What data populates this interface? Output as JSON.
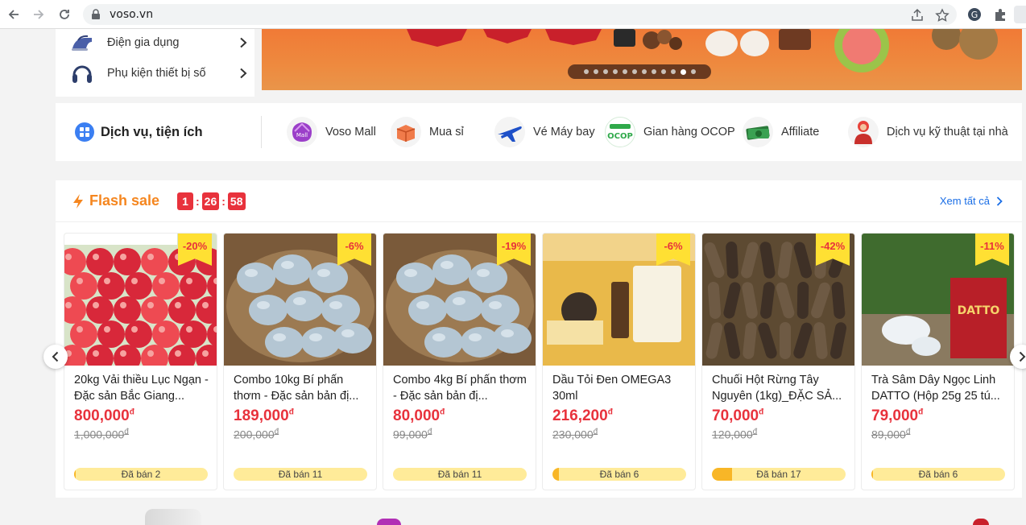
{
  "browser": {
    "url": "voso.vn"
  },
  "categories": [
    {
      "label": "Điện gia dụng",
      "icon": "iron-icon"
    },
    {
      "label": "Phụ kiện thiết bị số",
      "icon": "headphones-icon"
    }
  ],
  "banner": {
    "dot_count": 12,
    "active_dot": 10
  },
  "services": {
    "title": "Dịch vụ, tiện ích",
    "items": [
      {
        "label": "Voso Mall",
        "icon": "voso-mall-icon"
      },
      {
        "label": "Mua sỉ",
        "icon": "wholesale-box-icon"
      },
      {
        "label": "Vé Máy bay",
        "icon": "airplane-icon"
      },
      {
        "label": "Gian hàng OCOP",
        "icon": "ocop-icon"
      },
      {
        "label": "Affiliate",
        "icon": "money-icon"
      },
      {
        "label": "Dịch vụ kỹ thuật tại nhà",
        "icon": "technician-icon"
      }
    ]
  },
  "flash_sale": {
    "title": "Flash sale",
    "timer": [
      "1",
      "26",
      "58"
    ],
    "timer_sep": ":",
    "see_all": "Xem tất cả",
    "currency": "đ",
    "products": [
      {
        "name": "20kg Vải thiều Lục Ngạn - Đặc sản Bắc Giang...",
        "price": "800,000",
        "old_price": "1,000,000",
        "discount": "-20%",
        "sold": "Đã bán 2",
        "sold_ratio": 0.01
      },
      {
        "name": "Combo 10kg Bí phấn thơm - Đặc sản bản đị...",
        "price": "189,000",
        "old_price": "200,000",
        "discount": "-6%",
        "sold": "Đã bán 11",
        "sold_ratio": 0.0
      },
      {
        "name": "Combo 4kg Bí phấn thơm - Đặc sản bản đị...",
        "price": "80,000",
        "old_price": "99,000",
        "discount": "-19%",
        "sold": "Đã bán 11",
        "sold_ratio": 0.0
      },
      {
        "name": "Dầu Tỏi Đen OMEGA3 30ml",
        "price": "216,200",
        "old_price": "230,000",
        "discount": "-6%",
        "sold": "Đã bán 6",
        "sold_ratio": 0.05
      },
      {
        "name": "Chuối Hột Rừng Tây Nguyên (1kg)_ĐẶC SẢ...",
        "price": "70,000",
        "old_price": "120,000",
        "discount": "-42%",
        "sold": "Đã bán 17",
        "sold_ratio": 0.15
      },
      {
        "name": "Trà Sâm Dây Ngọc Linh DATTO (Hộp 25g 25 tú...",
        "price": "79,000",
        "old_price": "89,000",
        "discount": "-11%",
        "sold": "Đã bán 6",
        "sold_ratio": 0.01
      }
    ]
  }
}
